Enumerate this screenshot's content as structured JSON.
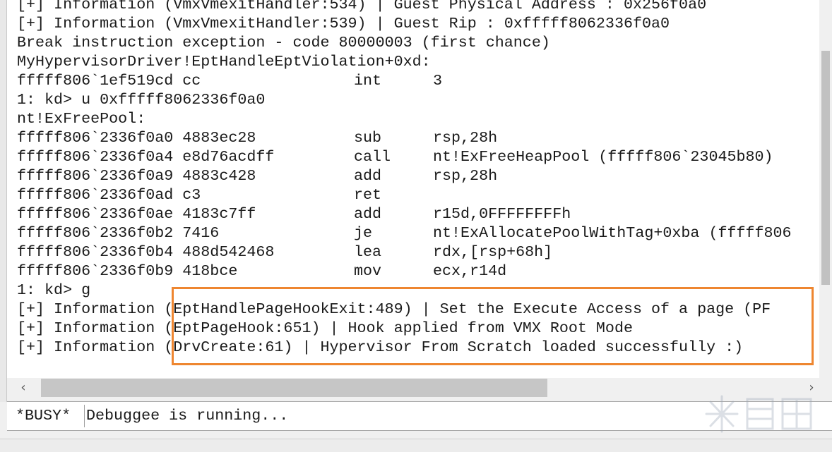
{
  "output": {
    "lines": [
      {
        "text": "[+] Information (VmxVmexitHandler:534) | Guest Physical Address : 0x256f0a0"
      },
      {
        "text": "[+] Information (VmxVmexitHandler:539) | Guest Rip : 0xfffff8062336f0a0"
      },
      {
        "text": "Break instruction exception - code 80000003 (first chance)"
      },
      {
        "text": "MyHypervisorDriver!EptHandleEptViolation+0xd:"
      },
      {
        "addr": "fffff806`1ef519cd cc",
        "mnemonic": "int",
        "operands": "3"
      },
      {
        "text": "1: kd> u 0xfffff8062336f0a0"
      },
      {
        "text": "nt!ExFreePool:"
      },
      {
        "addr": "fffff806`2336f0a0 4883ec28",
        "mnemonic": "sub",
        "operands": "rsp,28h"
      },
      {
        "addr": "fffff806`2336f0a4 e8d76acdff",
        "mnemonic": "call",
        "operands": "nt!ExFreeHeapPool (fffff806`23045b80)"
      },
      {
        "addr": "fffff806`2336f0a9 4883c428",
        "mnemonic": "add",
        "operands": "rsp,28h"
      },
      {
        "addr": "fffff806`2336f0ad c3",
        "mnemonic": "ret",
        "operands": ""
      },
      {
        "addr": "fffff806`2336f0ae 4183c7ff",
        "mnemonic": "add",
        "operands": "r15d,0FFFFFFFFh"
      },
      {
        "addr": "fffff806`2336f0b2 7416",
        "mnemonic": "je",
        "operands": "nt!ExAllocatePoolWithTag+0xba (fffff806"
      },
      {
        "addr": "fffff806`2336f0b4 488d542468",
        "mnemonic": "lea",
        "operands": "rdx,[rsp+68h]"
      },
      {
        "addr": "fffff806`2336f0b9 418bce",
        "mnemonic": "mov",
        "operands": "ecx,r14d"
      },
      {
        "text": "1: kd> g"
      },
      {
        "text": "[+] Information (EptHandlePageHookExit:489) | Set the Execute Access of a page (PF"
      },
      {
        "text": "[+] Information (EptPageHook:651) | Hook applied from VMX Root Mode"
      },
      {
        "text": "[+] Information (DrvCreate:61) | Hypervisor From Scratch loaded successfully :)"
      }
    ]
  },
  "scrollbar": {
    "left_arrow": "‹",
    "right_arrow": "›"
  },
  "command": {
    "prompt": "*BUSY*",
    "status": "Debuggee is running..."
  },
  "colors": {
    "highlight": "#ee8630",
    "background": "#ffffff",
    "chrome": "#f0f0f0"
  },
  "icons": {
    "watermark": "kanxue-watermark-icon"
  }
}
